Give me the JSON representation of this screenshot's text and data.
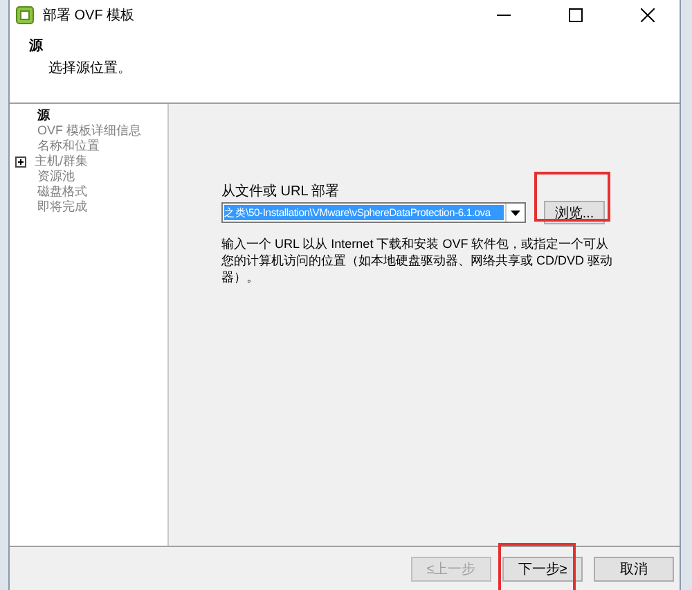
{
  "window": {
    "title": "部署 OVF 模板"
  },
  "header": {
    "title": "源",
    "subtitle": "选择源位置。"
  },
  "steps": [
    {
      "label": "源",
      "selected": true
    },
    {
      "label": "OVF 模板详细信息",
      "selected": false
    },
    {
      "label": "名称和位置",
      "selected": false
    },
    {
      "label": "主机/群集",
      "selected": false,
      "expanded": false
    },
    {
      "label": "资源池",
      "selected": false
    },
    {
      "label": "磁盘格式",
      "selected": false
    },
    {
      "label": "即将完成",
      "selected": false
    }
  ],
  "source": {
    "label": "从文件或 URL 部署",
    "value": "之类\\50-Installation\\VMware\\vSphereDataProtection-6.1.ova",
    "browse": {
      "label": "浏览...",
      "highlighted": true
    },
    "hint": "输入一个 URL 以从 Internet 下载和安装 OVF 软件包，或指定一个可从您的计算机访问的位置（如本地硬盘驱动器、网络共享或 CD/DVD 驱动器）。"
  },
  "buttons": [
    {
      "label": "≤上一步",
      "disabled": true,
      "highlighted": false
    },
    {
      "label": "下一步≥",
      "disabled": false,
      "highlighted": true
    },
    {
      "label": "取消",
      "disabled": false,
      "highlighted": false
    }
  ]
}
